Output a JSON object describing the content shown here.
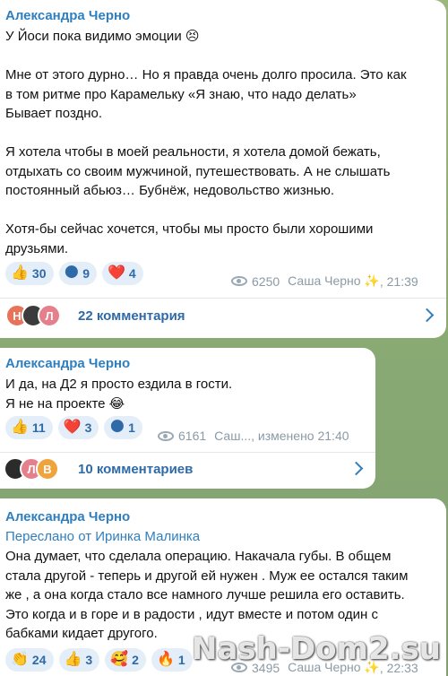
{
  "messages": [
    {
      "sender": "Александра Черно",
      "text": "У Йоси пока видимо эмоции 😣\n\nМне от этого дурно… Но я правда очень долго просила. Это как\nв том ритме про Карамельку «Я знаю, что надо делать»\nБывает поздно.\n\nЯ хотела чтобы в моей реальности, я хотела домой бежать,\nотдыхать со своим мужчиной, путешествовать. А не слышать\nпостоянный абьюз… Бубнёж, недовольство жизнью.\n\nХотя-бы сейчас хочется, чтобы мы просто были хорошими\nдрузьями.",
      "reactions": [
        {
          "emoji": "👍",
          "count": "30"
        },
        {
          "emoji": "🌑",
          "count": "9"
        },
        {
          "emoji": "❤️",
          "count": "4"
        }
      ],
      "views": "6250",
      "author_sign": "Саша Черно ✨",
      "time": ", 21:39",
      "avatars": [
        "Н",
        "",
        "Л"
      ],
      "comments": "22 комментария"
    },
    {
      "sender": "Александра Черно",
      "text": "И да, на Д2 я просто ездила в гости.\nЯ не на проекте 😂",
      "reactions": [
        {
          "emoji": "👍",
          "count": "11"
        },
        {
          "emoji": "❤️",
          "count": "3"
        },
        {
          "emoji": "🌑",
          "count": "1"
        }
      ],
      "views": "6161",
      "author_sign": "Саш...",
      "time": ", изменено 21:40",
      "avatars": [
        "",
        "Л",
        "В"
      ],
      "comments": "10 комментариев"
    },
    {
      "sender": "Александра Черно",
      "forwarded": "Переслано от Иринка Малинка",
      "text": "Она думает, что сделала операцию. Накачала губы. В общем\nстала другой - теперь и другой ей нужен . Муж ее остался таким\nже , а она когда стало все намного лучше решила его оставить.\nЭто когда и в горе и в радости , идут вместе и потом один с\nбабками кидает другого.",
      "reactions": [
        {
          "emoji": "👏",
          "count": "24"
        },
        {
          "emoji": "👍",
          "count": "3"
        },
        {
          "emoji": "🥰",
          "count": "2"
        },
        {
          "emoji": "🔥",
          "count": "1"
        }
      ],
      "views": "3495",
      "author_sign": "Саша Черно ✨",
      "time": ", 22:33"
    }
  ],
  "watermark": "Nash-Dom2.su",
  "colors": {
    "accent": "#2f7fbf",
    "bubble": "#ffffff",
    "background": "#8fae7a"
  }
}
